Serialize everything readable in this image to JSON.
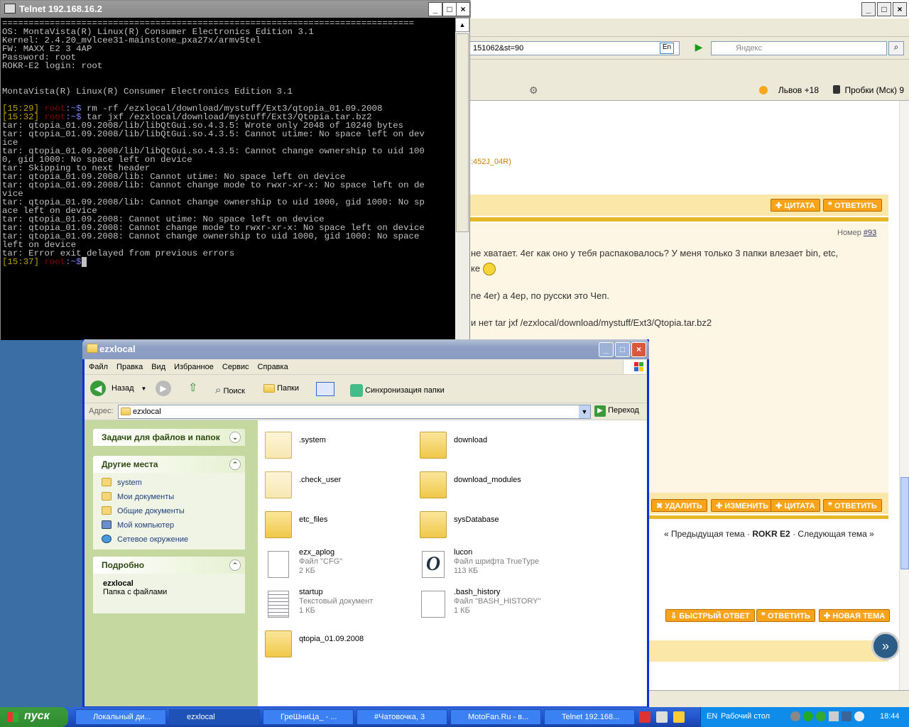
{
  "browser": {
    "url_fragment": "151062&st=90",
    "lang_badge": "En",
    "search_placeholder": "Яндекс",
    "weather": "Львов +18",
    "traffic": "Пробки (Мск) 9",
    "post_snippet": ":452J_04R)",
    "quote_label": "ЦИТАТА",
    "reply_label": "ОТВЕТИТЬ",
    "post_number_label": "Номер",
    "post_number": "#93",
    "text_line1": "не хватает. 4ег как оно у тебя распаковалось? У меня только 3 папки влезает bin, etc,",
    "text_line2": "ке",
    "text_line3": "ne 4er) а 4ер, по русски это Чеп.",
    "text_line4": "и нет tar jxf /ezxlocal/download/mystuff/Ext3/Qtopia.tar.bz2",
    "delete_label": "УДАЛИТЬ",
    "edit_label": "ИЗМЕНИТЬ",
    "nav_prev": "« Предыдущая тема",
    "nav_current": "ROKR E2",
    "nav_next": "Следующая тема »",
    "nav_sep": "·",
    "fast_reply_label": "БЫСТРЫЙ ОТВЕТ",
    "reply2_label": "ОТВЕТИТЬ",
    "new_topic_label": "НОВАЯ ТЕМА"
  },
  "telnet": {
    "title": "Telnet 192.168.16.2",
    "lines": [
      "==============================================================================",
      "OS: MontaVista(R) Linux(R) Consumer Electronics Edition 3.1",
      "Kernel: 2.4.20_mvlcee31-mainstone_pxa27x/armv5tel",
      "FW: MAXX E2 3 4AP",
      "Password: root",
      "ROKR-E2 login: root",
      "",
      "",
      "MontaVista(R) Linux(R) Consumer Electronics Edition 3.1",
      ""
    ],
    "cmd1_time": "[15:29]",
    "cmd1_user": "root",
    "cmd1_text": "rm -rf /ezxlocal/download/mystuff/Ext3/qtopia_01.09.2008",
    "cmd2_time": "[15:32]",
    "cmd2_user": "root",
    "cmd2_text": "tar jxf /ezxlocal/download/mystuff/Ext3/Qtopia.tar.bz2",
    "output": "tar: qtopia_01.09.2008/lib/libQtGui.so.4.3.5: Wrote only 2048 of 10240 bytes\ntar: qtopia_01.09.2008/lib/libQtGui.so.4.3.5: Cannot utime: No space left on dev\nice\ntar: qtopia_01.09.2008/lib/libQtGui.so.4.3.5: Cannot change ownership to uid 100\n0, gid 1000: No space left on device\ntar: Skipping to next header\ntar: qtopia_01.09.2008/lib: Cannot utime: No space left on device\ntar: qtopia_01.09.2008/lib: Cannot change mode to rwxr-xr-x: No space left on de\nvice\ntar: qtopia_01.09.2008/lib: Cannot change ownership to uid 1000, gid 1000: No sp\nace left on device\ntar: qtopia_01.09.2008: Cannot utime: No space left on device\ntar: qtopia_01.09.2008: Cannot change mode to rwxr-xr-x: No space left on device\ntar: qtopia_01.09.2008: Cannot change ownership to uid 1000, gid 1000: No space\nleft on device\ntar: Error exit delayed from previous errors",
    "cmd3_time": "[15:37]",
    "cmd3_user": "root"
  },
  "explorer": {
    "title": "ezxlocal",
    "menu": [
      "Файл",
      "Правка",
      "Вид",
      "Избранное",
      "Сервис",
      "Справка"
    ],
    "back_label": "Назад",
    "search_label": "Поиск",
    "folders_label": "Папки",
    "sync_label": "Синхронизация папки",
    "address_label": "Адрес:",
    "address_value": "ezxlocal",
    "go_label": "Переход",
    "tasks_header": "Задачи для файлов и папок",
    "other_header": "Другие места",
    "other_items": [
      "system",
      "Мои документы",
      "Общие документы",
      "Мой компьютер",
      "Сетевое окружение"
    ],
    "details_header": "Подробно",
    "details_name": "ezxlocal",
    "details_type": "Папка с файлами",
    "files": [
      {
        "name": ".system",
        "sub1": "",
        "sub2": ""
      },
      {
        "name": "download",
        "sub1": "",
        "sub2": ""
      },
      {
        "name": ".check_user",
        "sub1": "",
        "sub2": ""
      },
      {
        "name": "download_modules",
        "sub1": "",
        "sub2": ""
      },
      {
        "name": "etc_files",
        "sub1": "",
        "sub2": ""
      },
      {
        "name": "sysDatabase",
        "sub1": "",
        "sub2": ""
      },
      {
        "name": "ezx_aplog",
        "sub1": "Файл \"CFG\"",
        "sub2": "2 КБ"
      },
      {
        "name": "lucon",
        "sub1": "Файл шрифта TrueType",
        "sub2": "113 КБ"
      },
      {
        "name": "startup",
        "sub1": "Текстовый документ",
        "sub2": "1 КБ"
      },
      {
        "name": ".bash_history",
        "sub1": "Файл \"BASH_HISTORY\"",
        "sub2": "1 КБ"
      },
      {
        "name": "qtopia_01.09.2008",
        "sub1": "",
        "sub2": ""
      }
    ]
  },
  "taskbar": {
    "start_label": "пуск",
    "tasks": [
      "Локальный ди...",
      "ezxlocal",
      "ГреШниЦа_ - ...",
      "#Чатовочка, 3",
      "MotoFan.Ru - в...",
      "Telnet 192.168..."
    ],
    "lang": "EN",
    "desktop_label": "Рабочий стол",
    "clock": "18:44"
  }
}
